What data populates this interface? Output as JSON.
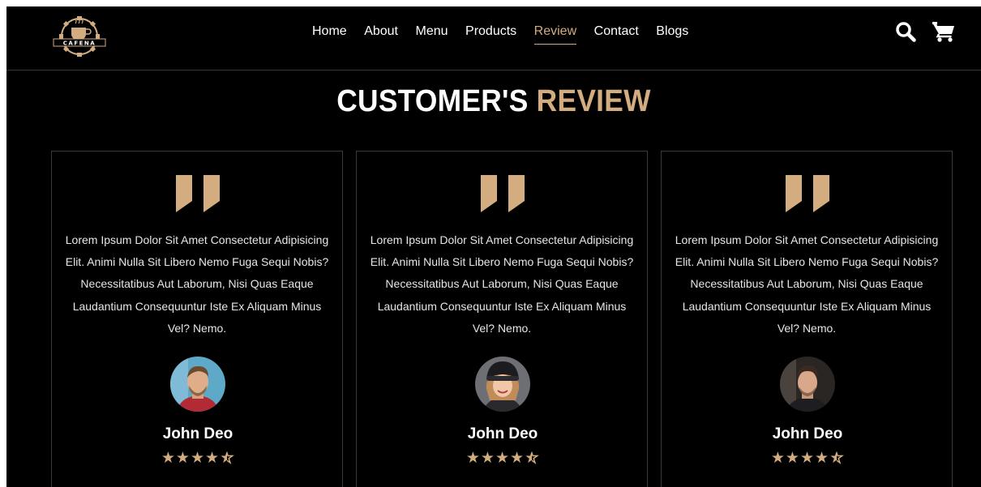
{
  "brand": {
    "logo_text": "CAFENA"
  },
  "nav": {
    "items": [
      {
        "label": "Home"
      },
      {
        "label": "About"
      },
      {
        "label": "Menu"
      },
      {
        "label": "Products"
      },
      {
        "label": "Review",
        "active": true
      },
      {
        "label": "Contact"
      },
      {
        "label": "Blogs"
      }
    ]
  },
  "header_icons": [
    "search-icon",
    "cart-icon"
  ],
  "section": {
    "title_main": "CUSTOMER'S",
    "title_accent": "REVIEW"
  },
  "reviews": [
    {
      "text": "Lorem Ipsum Dolor Sit Amet Consectetur Adipisicing Elit. Animi Nulla Sit Libero Nemo Fuga Sequi Nobis? Necessitatibus Aut Laborum, Nisi Quas Eaque Laudantium Consequuntur Iste Ex Aliquam Minus Vel? Nemo.",
      "name": "John Deo",
      "rating": 4.5,
      "avatar": "man-avatar"
    },
    {
      "text": "Lorem Ipsum Dolor Sit Amet Consectetur Adipisicing Elit. Animi Nulla Sit Libero Nemo Fuga Sequi Nobis? Necessitatibus Aut Laborum, Nisi Quas Eaque Laudantium Consequuntur Iste Ex Aliquam Minus Vel? Nemo.",
      "name": "John Deo",
      "rating": 4.5,
      "avatar": "woman-avatar"
    },
    {
      "text": "Lorem Ipsum Dolor Sit Amet Consectetur Adipisicing Elit. Animi Nulla Sit Libero Nemo Fuga Sequi Nobis? Necessitatibus Aut Laborum, Nisi Quas Eaque Laudantium Consequuntur Iste Ex Aliquam Minus Vel? Nemo.",
      "name": "John Deo",
      "rating": 4.5,
      "avatar": "man-avatar"
    }
  ],
  "colors": {
    "accent": "#d3ad7f",
    "background": "#000000",
    "border": "#3a3a3a"
  }
}
